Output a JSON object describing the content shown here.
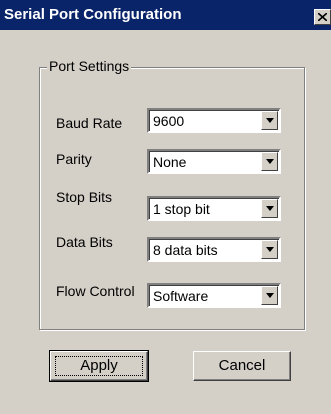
{
  "window": {
    "title": "Serial Port Configuration"
  },
  "group": {
    "legend": "Port Settings"
  },
  "fields": [
    {
      "label": "Baud Rate",
      "value": "9600"
    },
    {
      "label": "Parity",
      "value": "None"
    },
    {
      "label": "Stop Bits",
      "value": "1 stop bit"
    },
    {
      "label": "Data Bits",
      "value": "8 data bits"
    },
    {
      "label": "Flow Control",
      "value": "Software"
    }
  ],
  "buttons": {
    "apply": "Apply",
    "cancel": "Cancel"
  },
  "icons": {
    "close": "close-icon",
    "dropdown": "chevron-down-icon"
  },
  "colors": {
    "titlebar": "#0a246a",
    "dialog": "#d4d0c8"
  }
}
